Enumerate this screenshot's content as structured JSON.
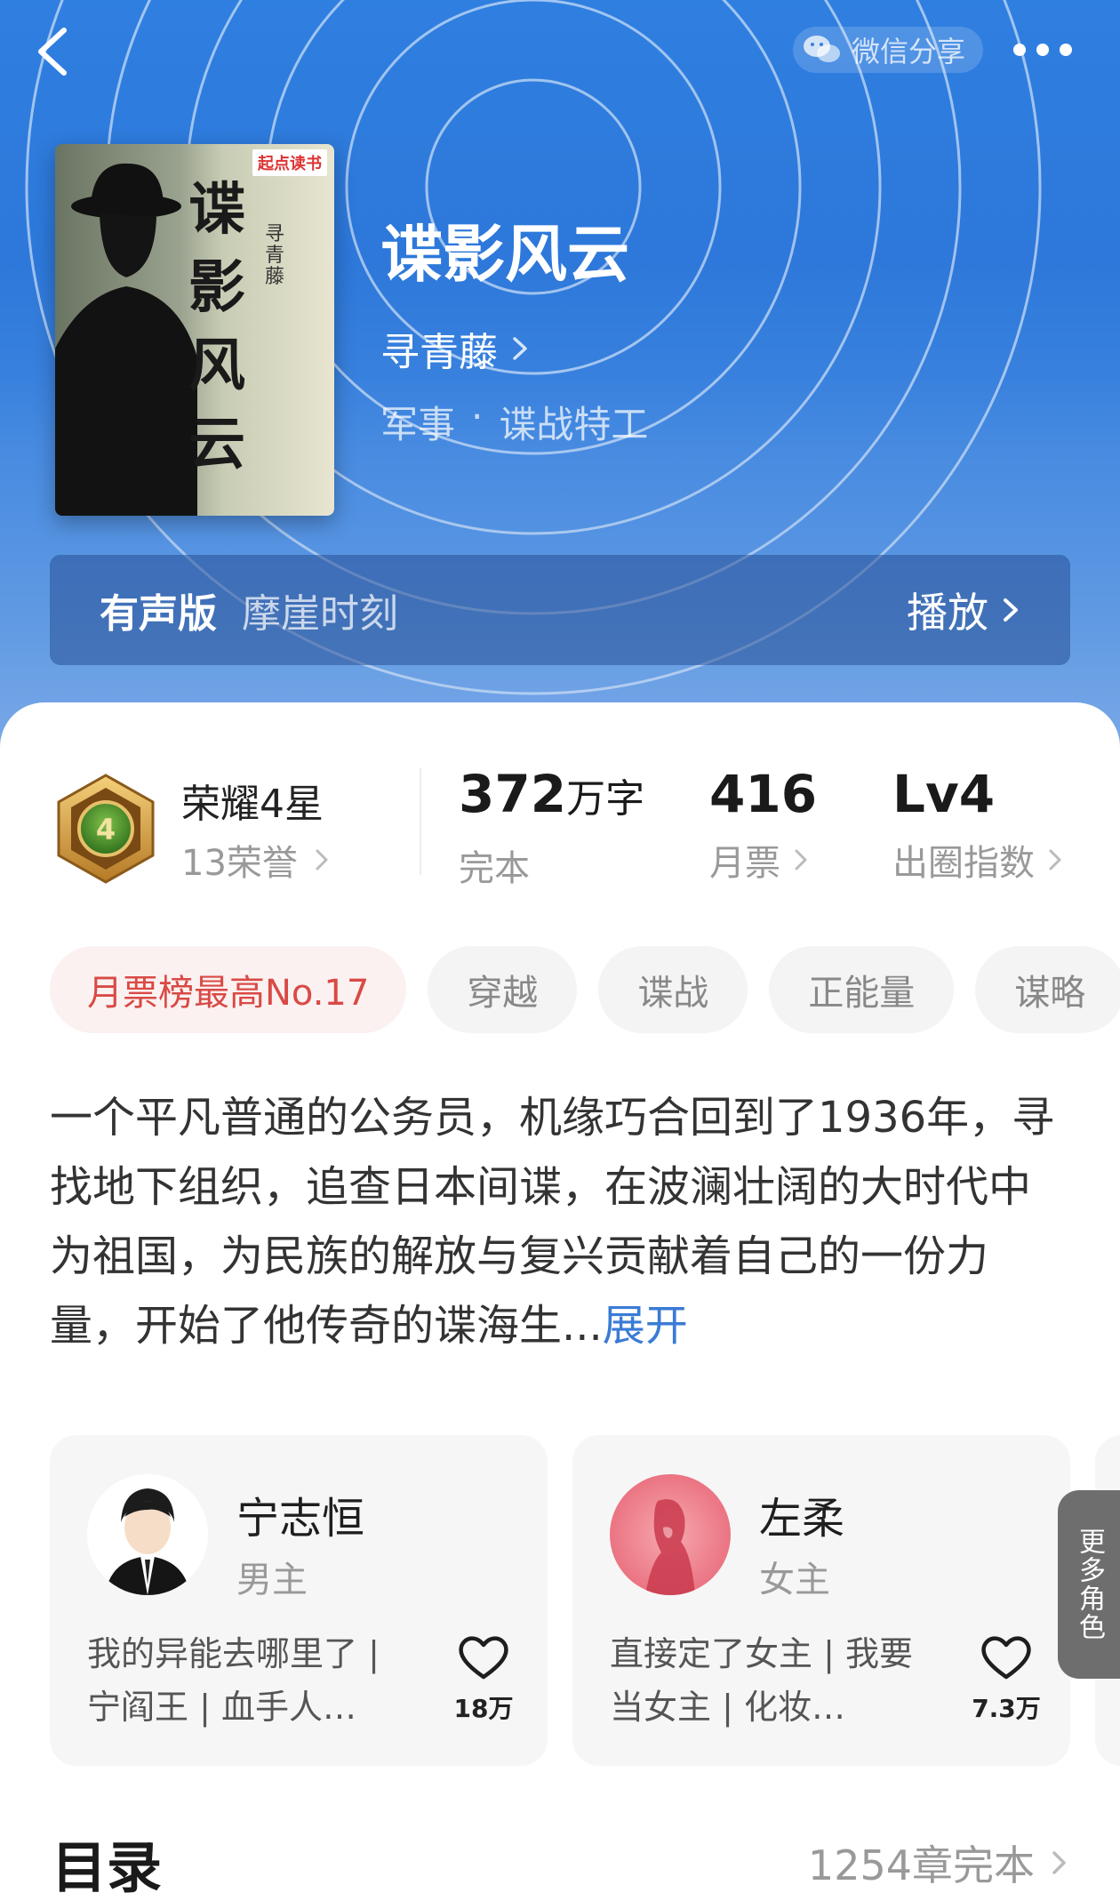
{
  "header": {
    "share_label": "微信分享"
  },
  "book": {
    "title": "谍影风云",
    "author": "寻青藤",
    "genre_main": "军事",
    "genre_sep": "·",
    "genre_sub": "谍战特工",
    "cover": {
      "brand": "起点读书",
      "title": "谍影风云",
      "author_vertical": "寻青藤"
    }
  },
  "audio": {
    "label": "有声版",
    "narrator": "摩崖时刻",
    "play_label": "播放"
  },
  "stats": {
    "honor_level": "荣耀4星",
    "honor_badge_number": "4",
    "honor_count": "13荣誉",
    "word_count": "372",
    "word_unit": "万字",
    "word_status": "完本",
    "monthly_votes": "416",
    "monthly_votes_label": "月票",
    "influence_level": "Lv4",
    "influence_label": "出圈指数"
  },
  "tags": [
    "月票榜最高No.17",
    "穿越",
    "谍战",
    "正能量",
    "谋略"
  ],
  "synopsis": {
    "text": "一个平凡普通的公务员，机缘巧合回到了1936年，寻找地下组织，追查日本间谍，在波澜壮阔的大时代中为祖国，为民族的解放与复兴贡献着自己的一份力量，开始了他传奇的谍海生...",
    "expand_label": "展开"
  },
  "roles": [
    {
      "name": "宁志恒",
      "type": "男主",
      "desc": "我的异能去哪里了 | 宁阎王 | 血手人…",
      "likes": "18万"
    },
    {
      "name": "左柔",
      "type": "女主",
      "desc": "直接定了女主 | 我要当女主 | 化妆…",
      "likes": "7.3万"
    }
  ],
  "more_roles_label": "更多角色",
  "toc": {
    "title": "目录",
    "summary": "1254章完本"
  }
}
